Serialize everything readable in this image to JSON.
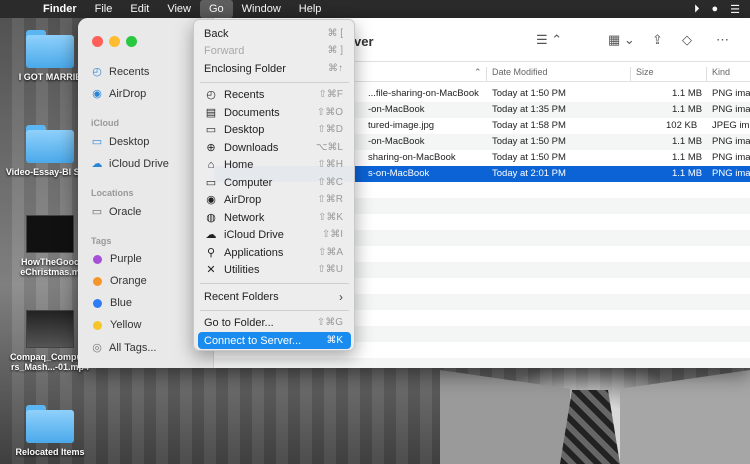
{
  "menubar": {
    "app": "Finder",
    "items": [
      "File",
      "Edit",
      "View",
      "Go",
      "Window",
      "Help"
    ]
  },
  "desktop": {
    "items": [
      {
        "label": "I GOT MARRIE"
      },
      {
        "label": "Video-Essay-Bl Stuff"
      },
      {
        "label": "HowTheGooc eChristmas.m"
      },
      {
        "label": "Compaq_Compute rs_Mash...-01.mp4"
      },
      {
        "label": "Relocated Items"
      }
    ]
  },
  "finder": {
    "title_fragment": "ver",
    "sidebar": {
      "favorites": [
        {
          "label": "Recents",
          "icon": "clock-icon"
        },
        {
          "label": "AirDrop",
          "icon": "airdrop-icon"
        }
      ],
      "icloud_header": "iCloud",
      "icloud": [
        {
          "label": "Desktop",
          "icon": "desktop-icon"
        },
        {
          "label": "iCloud Drive",
          "icon": "cloud-icon"
        }
      ],
      "locations_header": "Locations",
      "locations": [
        {
          "label": "Oracle",
          "icon": "laptop-icon"
        }
      ],
      "tags_header": "Tags",
      "tags": [
        {
          "label": "Purple",
          "color": "#a550d6"
        },
        {
          "label": "Orange",
          "color": "#f5962a"
        },
        {
          "label": "Blue",
          "color": "#2f7df6"
        },
        {
          "label": "Yellow",
          "color": "#f5c52a"
        },
        {
          "label": "All Tags...",
          "color": ""
        }
      ]
    },
    "columns": {
      "date": "Date Modified",
      "size": "Size",
      "kind": "Kind"
    },
    "rows": [
      {
        "name": "...file-sharing-on-MacBook",
        "date": "Today at 1:50 PM",
        "size": "1.1 MB",
        "kind": "PNG ima"
      },
      {
        "name": "-on-MacBook",
        "date": "Today at 1:35 PM",
        "size": "1.1 MB",
        "kind": "PNG ima"
      },
      {
        "name": "tured-image.jpg",
        "date": "Today at 1:58 PM",
        "size": "102 KB",
        "kind": "JPEG im"
      },
      {
        "name": "-on-MacBook",
        "date": "Today at 1:50 PM",
        "size": "1.1 MB",
        "kind": "PNG ima"
      },
      {
        "name": "sharing-on-MacBook",
        "date": "Today at 1:50 PM",
        "size": "1.1 MB",
        "kind": "PNG ima"
      },
      {
        "name": "s-on-MacBook",
        "date": "Today at 2:01 PM",
        "size": "1.1 MB",
        "kind": "PNG ima"
      }
    ]
  },
  "go_menu": {
    "top": [
      {
        "label": "Back",
        "shortcut": "⌘ [",
        "disabled": false
      },
      {
        "label": "Forward",
        "shortcut": "⌘ ]",
        "disabled": true
      },
      {
        "label": "Enclosing Folder",
        "shortcut": "⌘↑",
        "disabled": false
      }
    ],
    "places": [
      {
        "label": "Recents",
        "shortcut": "⇧⌘F",
        "icon": "clock-icon"
      },
      {
        "label": "Documents",
        "shortcut": "⇧⌘O",
        "icon": "document-icon"
      },
      {
        "label": "Desktop",
        "shortcut": "⇧⌘D",
        "icon": "desktop-icon"
      },
      {
        "label": "Downloads",
        "shortcut": "⌥⌘L",
        "icon": "download-icon"
      },
      {
        "label": "Home",
        "shortcut": "⇧⌘H",
        "icon": "home-icon"
      },
      {
        "label": "Computer",
        "shortcut": "⇧⌘C",
        "icon": "laptop-icon"
      },
      {
        "label": "AirDrop",
        "shortcut": "⇧⌘R",
        "icon": "airdrop-icon"
      },
      {
        "label": "Network",
        "shortcut": "⇧⌘K",
        "icon": "globe-icon"
      },
      {
        "label": "iCloud Drive",
        "shortcut": "⇧⌘I",
        "icon": "cloud-icon"
      },
      {
        "label": "Applications",
        "shortcut": "⇧⌘A",
        "icon": "apps-icon"
      },
      {
        "label": "Utilities",
        "shortcut": "⇧⌘U",
        "icon": "tools-icon"
      }
    ],
    "recent_folders": "Recent Folders",
    "go_to_folder": {
      "label": "Go to Folder...",
      "shortcut": "⇧⌘G"
    },
    "connect": {
      "label": "Connect to Server...",
      "shortcut": "⌘K"
    }
  }
}
